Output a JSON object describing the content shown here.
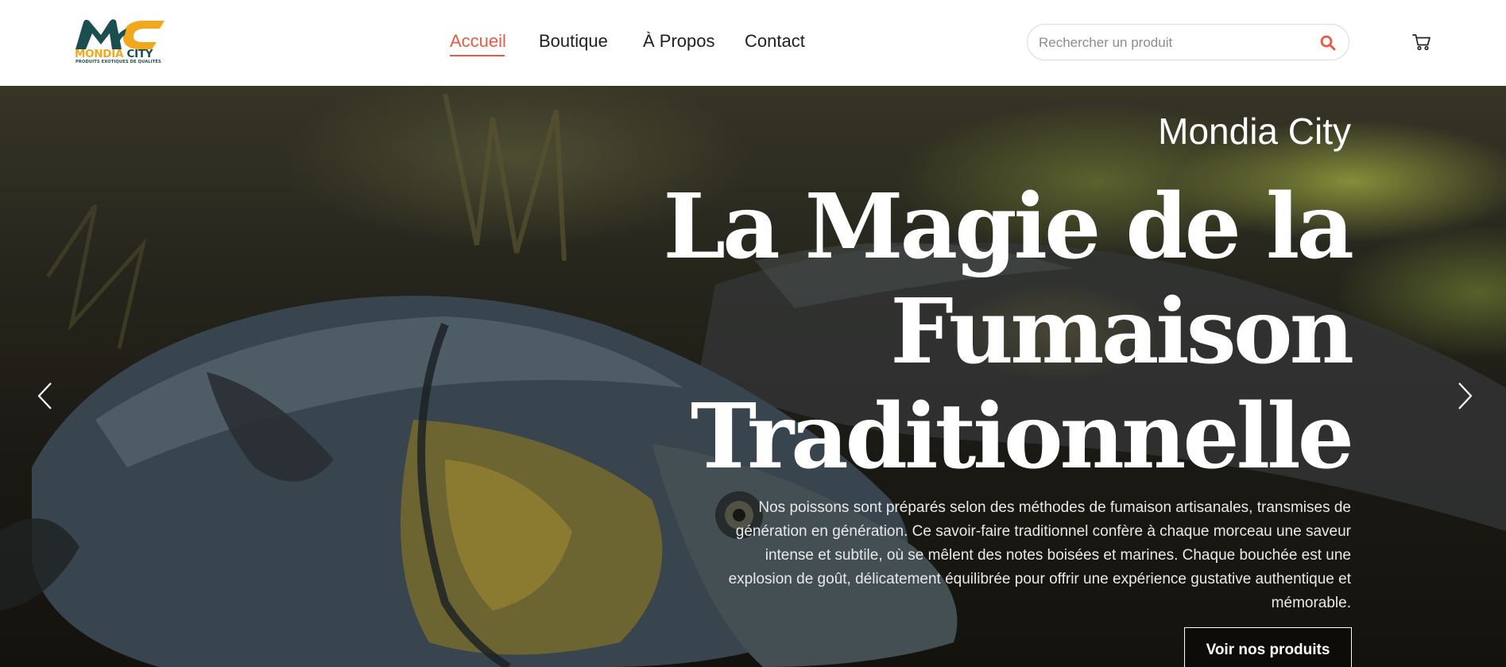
{
  "brand": {
    "logo_letters": "MC",
    "logo_name_part1": "MONDIA",
    "logo_name_part2": "CITY",
    "logo_tagline": "PRODUITS EXOTIQUES DE QUALITÉS"
  },
  "nav": {
    "items": [
      {
        "label": "Accueil",
        "active": true
      },
      {
        "label": "Boutique",
        "active": false
      },
      {
        "label": "À Propos",
        "active": false
      },
      {
        "label": "Contact",
        "active": false
      }
    ]
  },
  "search": {
    "placeholder": "Rechercher un produit",
    "value": "",
    "icon": "search-icon"
  },
  "cart": {
    "icon": "cart-icon"
  },
  "hero": {
    "brand": "Mondia City",
    "title": "La Magie de la Fumaison Traditionnelle",
    "text": "Nos poissons sont préparés selon des méthodes de fumaison artisanales, transmises de génération en génération. Ce savoir-faire traditionnel confère à chaque morceau une saveur intense et subtile, où se mêlent des notes boisées et marines. Chaque bouchée est une explosion de goût, délicatement équilibrée pour offrir une expérience gustative authentique et mémorable.",
    "button_label": "Voir nos produits",
    "prev_icon": "chevron-left-icon",
    "next_icon": "chevron-right-icon"
  },
  "colors": {
    "accent": "#ec5a44",
    "logo_teal": "#1b4f4f",
    "logo_orange": "#f2a81d",
    "text_dark": "#1f1f1f"
  }
}
